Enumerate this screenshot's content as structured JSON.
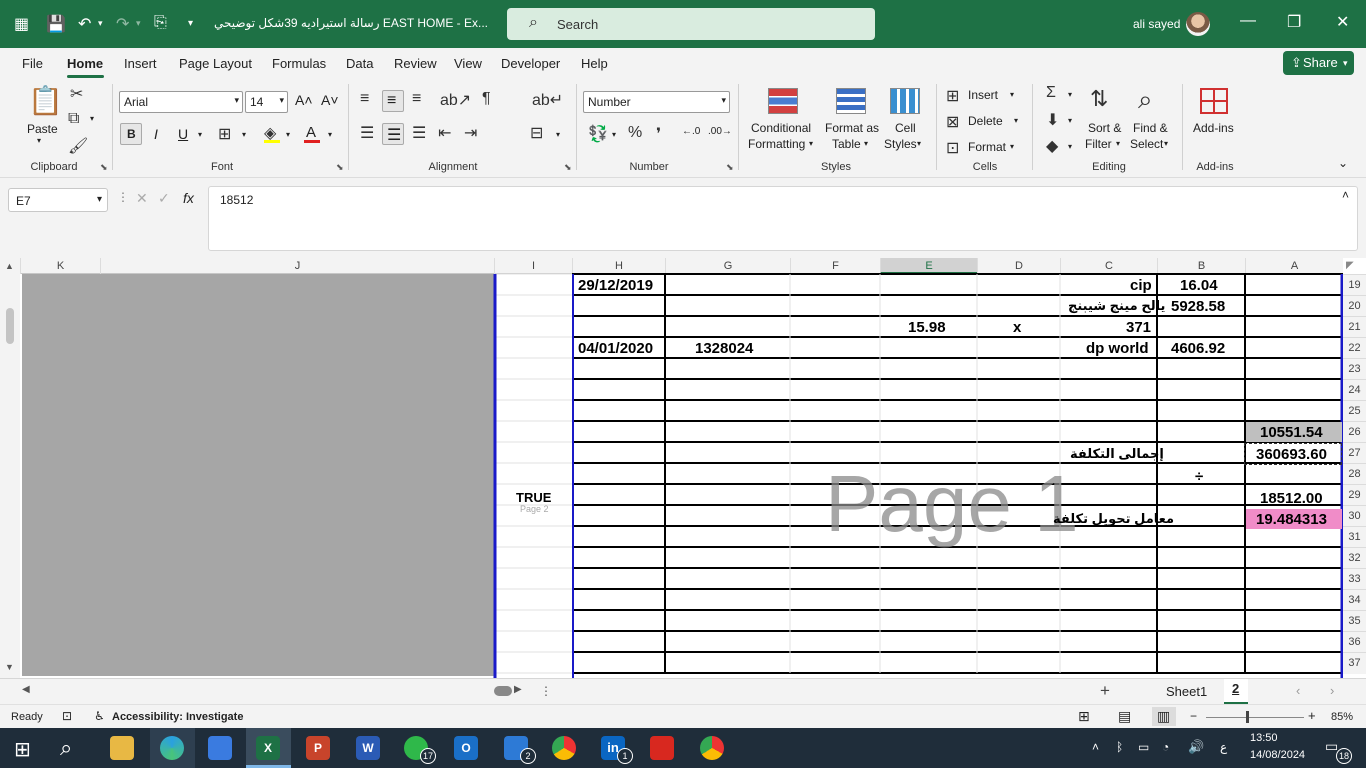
{
  "titlebar": {
    "doc_title": "رسالة استيراديه 39شكل توضيحي EAST HOME  -  Ex...",
    "search_label": "Search",
    "user_name": "ali sayed"
  },
  "menu": {
    "items": [
      "File",
      "Home",
      "Insert",
      "Page Layout",
      "Formulas",
      "Data",
      "Review",
      "View",
      "Developer",
      "Help"
    ],
    "share": "Share"
  },
  "ribbon": {
    "clipboard": {
      "paste": "Paste",
      "label": "Clipboard"
    },
    "font": {
      "name": "Arial",
      "size": "14",
      "label": "Font",
      "bold": "B",
      "italic": "I",
      "underline": "U"
    },
    "alignment": {
      "label": "Alignment"
    },
    "number": {
      "format": "Number",
      "label": "Number"
    },
    "styles": {
      "conditional": "Conditional",
      "conditional2": "Formatting",
      "format_as": "Format as",
      "format_as2": "Table",
      "cell": "Cell",
      "cell2": "Styles",
      "label": "Styles"
    },
    "cells": {
      "insert": "Insert",
      "delete": "Delete",
      "format": "Format",
      "label": "Cells"
    },
    "editing": {
      "sort": "Sort &",
      "sort2": "Filter",
      "find": "Find &",
      "find2": "Select",
      "label": "Editing"
    },
    "addins": {
      "btn": "Add-ins",
      "label": "Add-ins"
    }
  },
  "formula": {
    "namebox": "E7",
    "value": "18512"
  },
  "columns": [
    "K",
    "J",
    "I",
    "H",
    "G",
    "F",
    "E",
    "D",
    "C",
    "B",
    "A"
  ],
  "rows": [
    "19",
    "20",
    "21",
    "22",
    "23",
    "24",
    "25",
    "26",
    "27",
    "28",
    "29",
    "30",
    "31",
    "32",
    "33",
    "34",
    "35",
    "36",
    "37"
  ],
  "cells": {
    "h19": "29/12/2019",
    "c19": "cip",
    "b19": "16.04",
    "c20": "يالح مينج شيبنج",
    "b20": "5928.58",
    "e21": "15.98",
    "d21": "x",
    "c21": "371",
    "h22": "04/01/2020",
    "g22": "1328024",
    "c22": "dp world",
    "b22": "4606.92",
    "a26": "10551.54",
    "c27": "إجمالى التكلفة",
    "a27": "360693.60",
    "b28": "÷",
    "i29": "TRUE",
    "a29": "18512.00",
    "c30": "معامل تحويل تكلفة",
    "a30": "19.484313",
    "page2": "Page 2",
    "watermark": "Page 1"
  },
  "tabs": {
    "sheet1": "Sheet1",
    "sheet2": "2"
  },
  "status": {
    "ready": "Ready",
    "accessibility": "Accessibility: Investigate",
    "zoom": "85%"
  },
  "taskbar": {
    "time": "13:50",
    "date": "14/08/2024",
    "lang": "ع",
    "whatsapp_badge": "17",
    "todo_badge": "2",
    "linkedin_badge": "1",
    "notif_badge": "18"
  },
  "colors": {
    "excel_green": "#1e7145",
    "print_border": "#1a1ac8",
    "gray_fill": "#bfbfbf",
    "pink_fill": "#f08cc8"
  }
}
